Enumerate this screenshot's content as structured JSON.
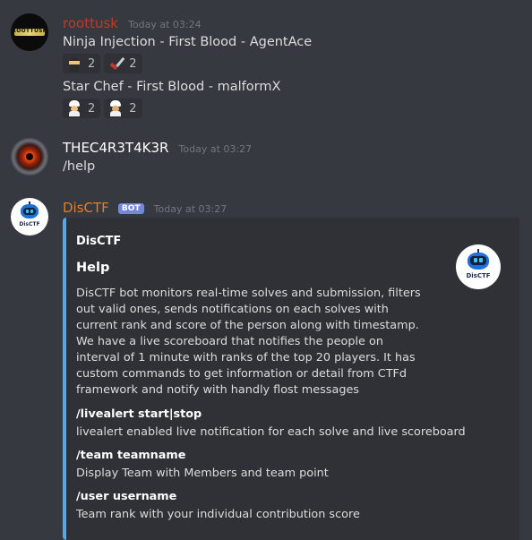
{
  "messages": [
    {
      "username": "roottusk",
      "username_color": "#c0392b",
      "avatar_text": "ROOTTUSK",
      "timestamp": "Today at 03:24",
      "lines": [
        {
          "text": "Ninja Injection - First Blood - AgentAce",
          "reactions": [
            {
              "emoji": "ninja",
              "count": "2"
            },
            {
              "emoji": "dagger",
              "count": "2"
            }
          ]
        },
        {
          "text": "Star Chef - First Blood - malformX",
          "reactions": [
            {
              "emoji": "chef",
              "count": "2"
            },
            {
              "emoji": "chef-woman",
              "count": "2"
            }
          ]
        }
      ]
    },
    {
      "username": "THEC4R3T4K3R",
      "username_color": "#ffffff",
      "timestamp": "Today at 03:27",
      "text": "/help"
    },
    {
      "username": "DisCTF",
      "username_color": "#e67e22",
      "bot_tag": "BOT",
      "timestamp": "Today at 03:27",
      "embed": {
        "color": "#4fa9ee",
        "author": "DisCTF",
        "title": "Help",
        "thumbnail_label": "DisCTF",
        "description": "DisCTF bot monitors real-time solves and submission, filters out valid ones, sends notifications on each solves with current rank and score of the person along with timestamp. We have a live scoreboard that notifies the people on interval of 1 minute with ranks of the top 20 players. It has custom commands to get information or detail from CTFd framework and notify with handly flost messages",
        "fields": [
          {
            "name": "/livealert start|stop",
            "value": "livealert enabled live notification for each solve and live scoreboard"
          },
          {
            "name": "/team teamname",
            "value": "Display Team with Members and team point"
          },
          {
            "name": "/user username",
            "value": "Team rank with your individual contribution score"
          }
        ]
      }
    }
  ],
  "avatar_labels": {
    "disctf": "DisCTF"
  }
}
